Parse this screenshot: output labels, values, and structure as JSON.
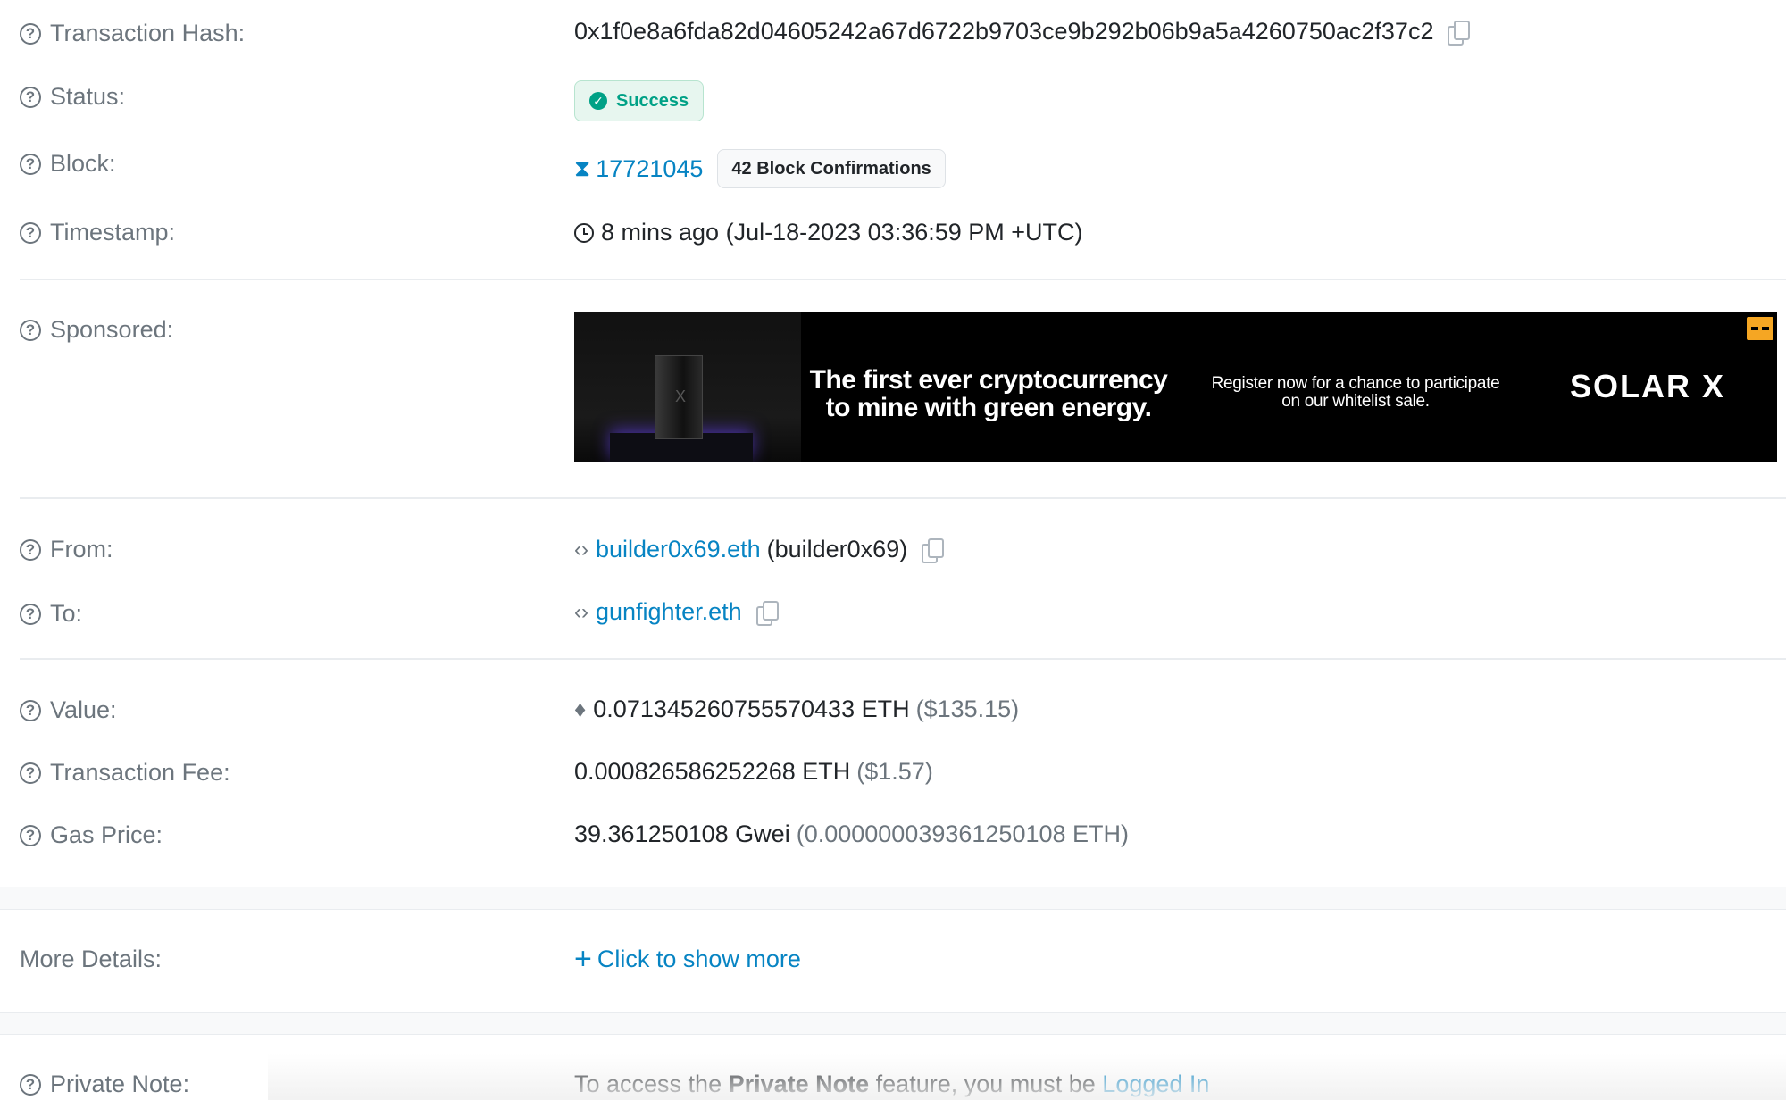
{
  "labels": {
    "tx_hash": "Transaction Hash:",
    "status": "Status:",
    "block": "Block:",
    "timestamp": "Timestamp:",
    "sponsored": "Sponsored:",
    "from": "From:",
    "to": "To:",
    "value": "Value:",
    "fee": "Transaction Fee:",
    "gas_price": "Gas Price:",
    "more_details": "More Details:",
    "private_note": "Private Note:"
  },
  "tx": {
    "hash": "0x1f0e8a6fda82d04605242a67d6722b9703ce9b292b06b9a5a4260750ac2f37c2",
    "status": "Success",
    "block_number": "17721045",
    "confirmations": "42 Block Confirmations",
    "timestamp": "8 mins ago (Jul-18-2023 03:36:59 PM +UTC)",
    "from_name": "builder0x69.eth",
    "from_alias": "(builder0x69)",
    "to_name": "gunfighter.eth",
    "value_eth": "0.071345260755570433 ETH",
    "value_usd": "($135.15)",
    "fee_eth": "0.000826586252268 ETH",
    "fee_usd": "($1.57)",
    "gas_gwei": "39.361250108 Gwei",
    "gas_eth": "(0.000000039361250108 ETH)"
  },
  "ad": {
    "headline_line1": "The first ever cryptocurrency",
    "headline_line2": "to mine with green energy.",
    "sub_line1": "Register now for a chance to participate",
    "sub_line2": "on our whitelist sale.",
    "brand": "SOLAR X",
    "rig_mark": "X"
  },
  "more": {
    "link": "Click to show more"
  },
  "private_note": {
    "prefix": "To access the ",
    "feature": "Private Note",
    "suffix": " feature, you must be ",
    "login_link": "Logged In"
  },
  "colors": {
    "link": "#0784c3",
    "success": "#00a186",
    "label": "#6c757d"
  },
  "icons": [
    "question-icon",
    "copy-icon",
    "check-circle-icon",
    "hourglass-icon",
    "clock-icon",
    "contract-icon",
    "eth-icon",
    "plus-icon",
    "adchoices-icon"
  ]
}
